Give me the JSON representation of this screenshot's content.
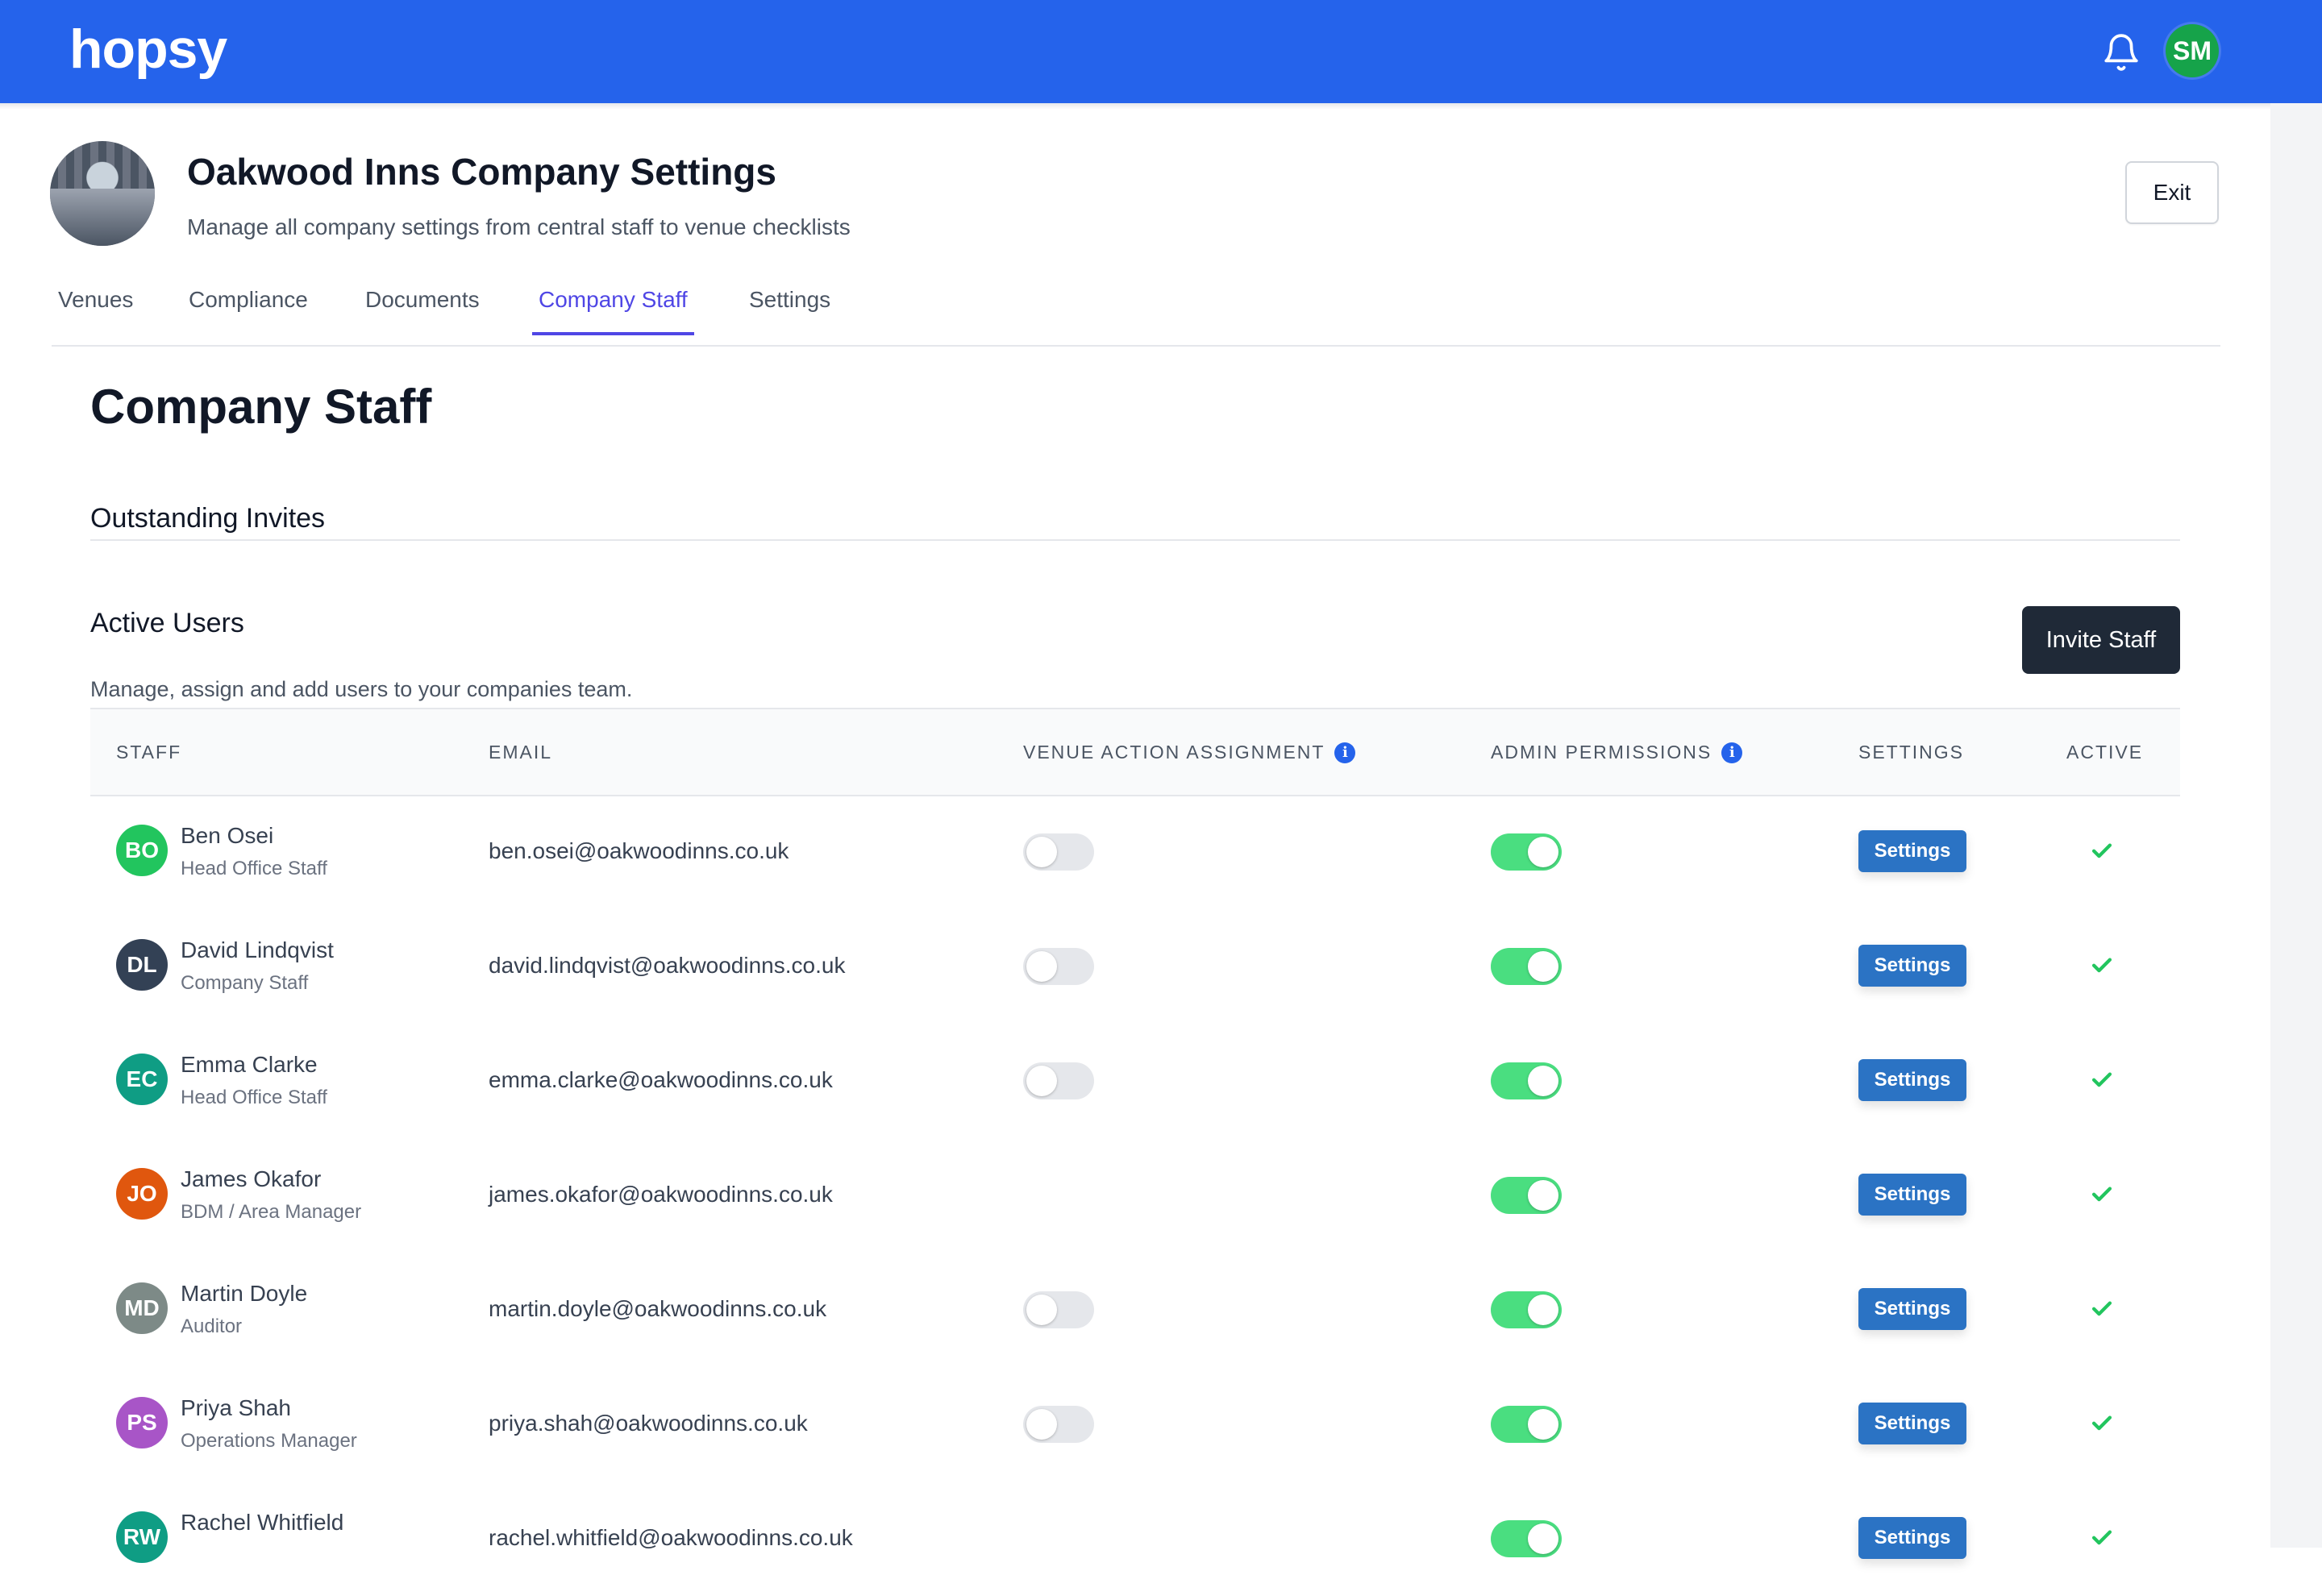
{
  "app": {
    "logo": "hopsy",
    "user_initials": "SM",
    "accent": "#2563eb"
  },
  "header": {
    "title": "Oakwood Inns Company Settings",
    "subtitle": "Manage all company settings from central staff to venue checklists",
    "exit_label": "Exit"
  },
  "tabs": [
    {
      "label": "Venues",
      "active": false
    },
    {
      "label": "Compliance",
      "active": false
    },
    {
      "label": "Documents",
      "active": false
    },
    {
      "label": "Company Staff",
      "active": true
    },
    {
      "label": "Settings",
      "active": false
    }
  ],
  "page": {
    "heading": "Company Staff",
    "outstanding_title": "Outstanding Invites",
    "active_title": "Active Users",
    "active_desc": "Manage, assign and add users to your companies team.",
    "invite_label": "Invite Staff"
  },
  "table": {
    "columns": [
      "STAFF",
      "EMAIL",
      "VENUE ACTION ASSIGNMENT",
      "ADMIN PERMISSIONS",
      "SETTINGS",
      "ACTIVE"
    ],
    "settings_label": "Settings",
    "rows": [
      {
        "initials": "BO",
        "color": "#22c55e",
        "name": "Ben Osei",
        "role": "Head Office Staff",
        "email": "ben.osei@oakwoodinns.co.uk",
        "venue_toggle": "off",
        "admin": true,
        "active": true
      },
      {
        "initials": "DL",
        "color": "#334155",
        "name": "David Lindqvist",
        "role": "Company Staff",
        "email": "david.lindqvist@oakwoodinns.co.uk",
        "venue_toggle": "off",
        "admin": true,
        "active": true
      },
      {
        "initials": "EC",
        "color": "#0f9d84",
        "name": "Emma Clarke",
        "role": "Head Office Staff",
        "email": "emma.clarke@oakwoodinns.co.uk",
        "venue_toggle": "off",
        "admin": true,
        "active": true
      },
      {
        "initials": "JO",
        "color": "#e0570e",
        "name": "James Okafor",
        "role": "BDM / Area Manager",
        "email": "james.okafor@oakwoodinns.co.uk",
        "venue_toggle": "none",
        "admin": true,
        "active": true
      },
      {
        "initials": "MD",
        "color": "#7d8a87",
        "name": "Martin Doyle",
        "role": "Auditor",
        "email": "martin.doyle@oakwoodinns.co.uk",
        "venue_toggle": "off",
        "admin": true,
        "active": true
      },
      {
        "initials": "PS",
        "color": "#a855c7",
        "name": "Priya Shah",
        "role": "Operations Manager",
        "email": "priya.shah@oakwoodinns.co.uk",
        "venue_toggle": "off",
        "admin": true,
        "active": true
      },
      {
        "initials": "RW",
        "color": "#0f9d84",
        "name": "Rachel Whitfield",
        "role": "",
        "email": "rachel.whitfield@oakwoodinns.co.uk",
        "venue_toggle": "none",
        "admin": true,
        "active": true
      }
    ]
  }
}
